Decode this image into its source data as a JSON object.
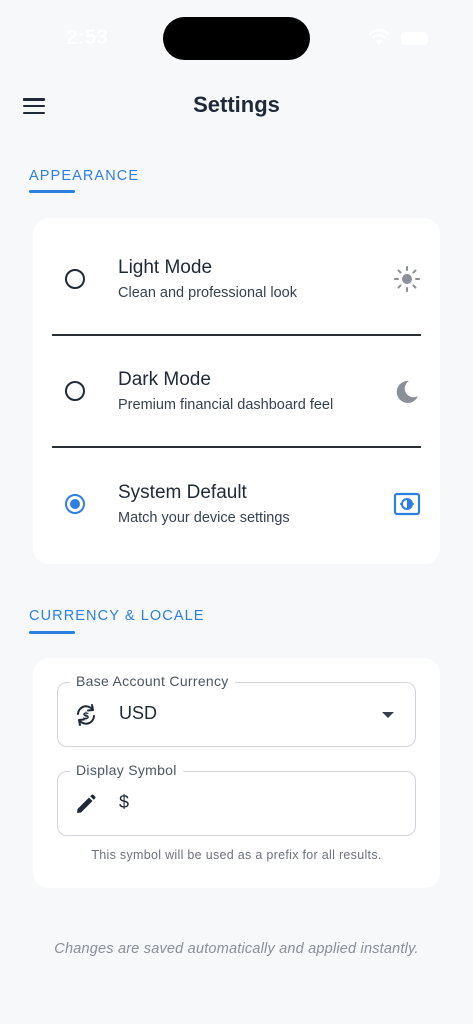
{
  "status_bar": {
    "time": "2:53"
  },
  "header": {
    "title": "Settings",
    "menu_icon": "hamburger-menu-icon"
  },
  "appearance": {
    "section_title": "APPEARANCE",
    "options": [
      {
        "title": "Light Mode",
        "subtitle": "Clean and professional look",
        "icon": "sun-icon",
        "selected": false
      },
      {
        "title": "Dark Mode",
        "subtitle": "Premium financial dashboard feel",
        "icon": "moon-icon",
        "selected": false
      },
      {
        "title": "System Default",
        "subtitle": "Match your device settings",
        "icon": "brightness-auto-icon",
        "selected": true
      }
    ]
  },
  "currency": {
    "section_title": "CURRENCY & LOCALE",
    "base_currency": {
      "label": "Base Account Currency",
      "value": "USD",
      "icon": "currency-exchange-icon"
    },
    "display_symbol": {
      "label": "Display Symbol",
      "value": "$",
      "icon": "pencil-icon"
    },
    "helper_text": "This symbol will be used as a prefix for all results."
  },
  "footer_note": "Changes are saved automatically and applied instantly.",
  "colors": {
    "accent": "#2f7fe0",
    "background": "#f6f8fa",
    "card": "#ffffff",
    "text": "#1f2937"
  }
}
